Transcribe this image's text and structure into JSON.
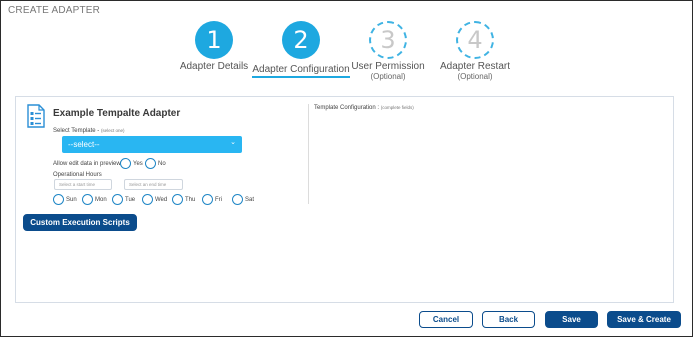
{
  "window": {
    "title": "CREATE ADAPTER"
  },
  "steps": [
    {
      "number": "1",
      "label": "Adapter Details",
      "sub": ""
    },
    {
      "number": "2",
      "label": "Adapter Configuration",
      "sub": ""
    },
    {
      "number": "3",
      "label": "User Permission",
      "sub": "(Optional)"
    },
    {
      "number": "4",
      "label": "Adapter Restart",
      "sub": "(Optional)"
    }
  ],
  "form": {
    "panel_title": "Example Tempalte Adapter",
    "template_label": "Select Template",
    "template_hint": "(select one)",
    "template_value": "--select--",
    "allow_edit_label": "Allow edit data in preview",
    "yes_label": "Yes",
    "no_label": "No",
    "operational_hours_label": "Operational Hours",
    "start_time_placeholder": "Select a start time",
    "end_time_placeholder": "Select an end time",
    "days": [
      "Sun",
      "Mon",
      "Tue",
      "Wed",
      "Thu",
      "Fri",
      "Sat"
    ],
    "custom_scripts_label": "Custom Execution Scripts"
  },
  "template_config": {
    "label": "Template Configuration",
    "hint": "(complete fields)"
  },
  "footer": {
    "cancel_label": "Cancel",
    "back_label": "Back",
    "save_label": "Save",
    "save_create_label": "Save & Create"
  },
  "colors": {
    "accent": "#1ea8e0",
    "select_bg": "#29b6f2",
    "primary_button": "#0b4c8c"
  },
  "icons": [
    "document-form-icon",
    "chevron-down-icon"
  ]
}
